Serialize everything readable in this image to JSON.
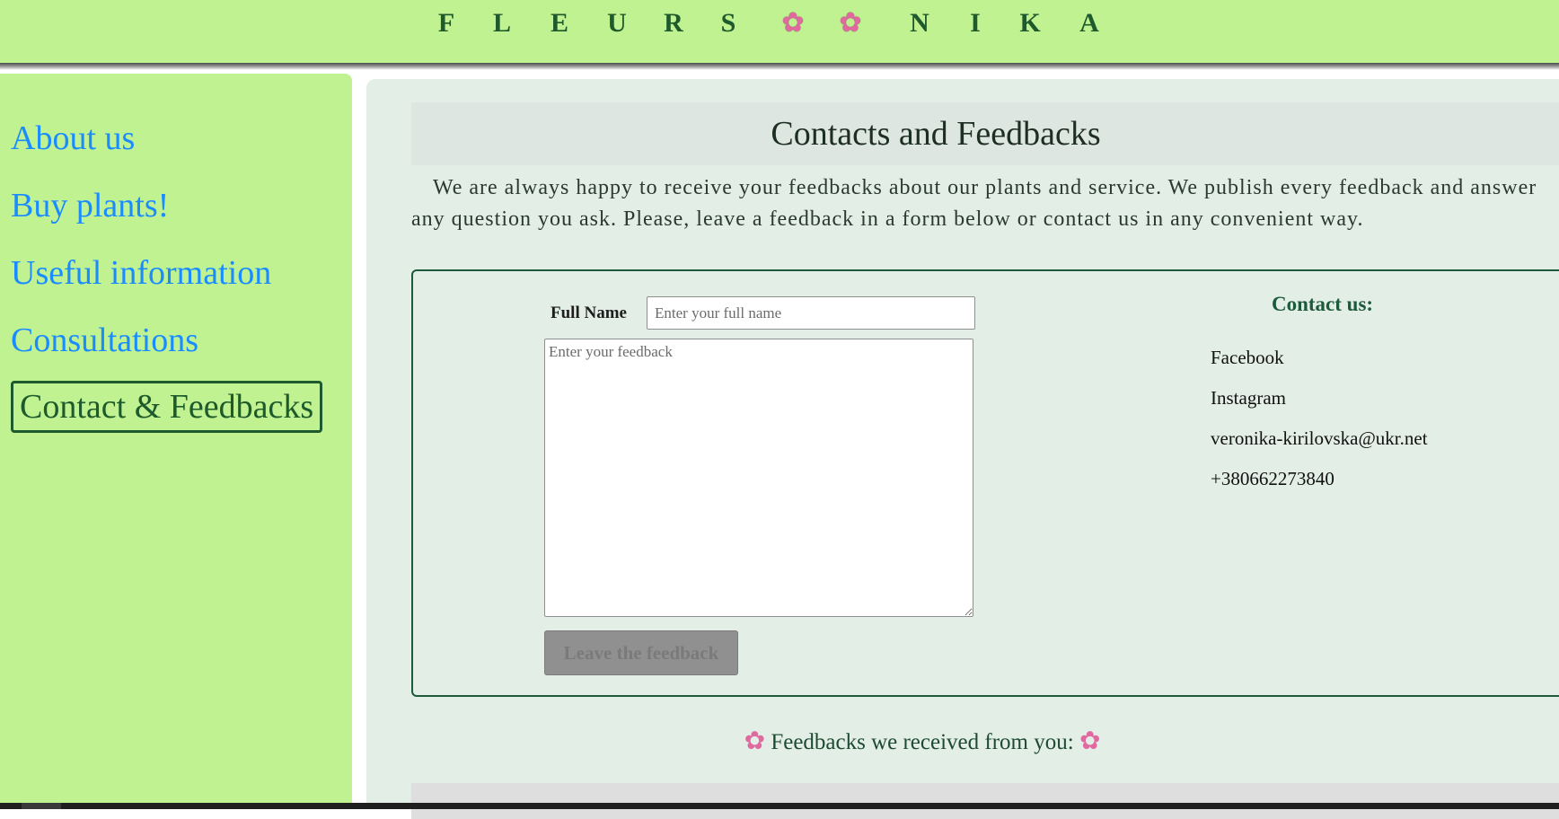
{
  "header": {
    "logo_letters": [
      "F",
      "L",
      "E",
      "U",
      "R",
      "S",
      "✿",
      "✿",
      "N",
      "I",
      "K",
      "A"
    ]
  },
  "sidebar": {
    "items": [
      {
        "label": "About us"
      },
      {
        "label": "Buy plants!"
      },
      {
        "label": "Useful information"
      },
      {
        "label": "Consultations"
      },
      {
        "label": "Contact & Feedbacks",
        "active": true
      }
    ]
  },
  "main": {
    "title": "Contacts and Feedbacks",
    "intro": "We are always happy to receive your feedbacks about our plants and service. We publish every feedback and answer any question you ask. Please, leave a feedback in a form below or contact us in any convenient way.",
    "form": {
      "fullname_label": "Full Name",
      "fullname_placeholder": "Enter your full name",
      "feedback_placeholder": "Enter your feedback",
      "submit_label": "Leave the feedback"
    },
    "contact": {
      "title": "Contact us:",
      "items": [
        "Facebook",
        "Instagram",
        "veronika-kirilovska@ukr.net",
        "+380662273840"
      ]
    },
    "received_title": "Feedbacks we received from you:"
  },
  "colors": {
    "header_bg": "#c1f291",
    "sidebar_bg": "#c1f291",
    "nav_link": "#1a8cff",
    "nav_active": "#1d5a2c",
    "main_bg": "#e3eee7",
    "form_border": "#1d5a3c",
    "flower": "#e06aa0"
  }
}
